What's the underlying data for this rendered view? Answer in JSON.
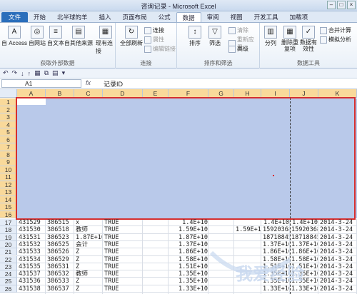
{
  "window": {
    "title": "咨询记录 - Microsoft Excel"
  },
  "tabs": [
    "文件",
    "开始",
    "北半球的羊",
    "插入",
    "页面布局",
    "公式",
    "数据",
    "审阅",
    "视图",
    "开发工具",
    "加载项"
  ],
  "ribbon": {
    "group1": {
      "label": "获取外部数据",
      "buttons": [
        "自 Access",
        "自网站",
        "自文本",
        "自其他来源",
        "现有连接"
      ]
    },
    "group2": {
      "label": "连接",
      "buttons": [
        "全部刷新"
      ],
      "small": [
        "连接",
        "属性",
        "编辑链接"
      ]
    },
    "group3": {
      "label": "排序和筛选",
      "buttons": [
        "排序",
        "筛选"
      ],
      "small": [
        "清除",
        "重新应用",
        "高级"
      ]
    },
    "group4": {
      "label": "数据工具",
      "buttons": [
        "分列",
        "删除重复项",
        "数据有效性",
        "合并计算",
        "模拟分析"
      ]
    }
  },
  "formula_bar": {
    "name_box": "A1",
    "fx": "fx",
    "value": "记录ID"
  },
  "columns": [
    "A",
    "B",
    "C",
    "D",
    "E",
    "F",
    "G",
    "H",
    "I",
    "J",
    "K"
  ],
  "selected_rows": [
    "1",
    "2",
    "3",
    "4",
    "5",
    "6",
    "7",
    "8",
    "9",
    "10",
    "11",
    "12",
    "13",
    "14",
    "15",
    "16"
  ],
  "rows": [
    {
      "n": "17",
      "a": "431529",
      "b": "386515",
      "c": "x",
      "d": "TRUE",
      "f": "1.4E+10",
      "h": "",
      "i": "1.4E+10",
      "j": "1.4E+10",
      "k": "2014-3-24"
    },
    {
      "n": "18",
      "a": "431530",
      "b": "386518",
      "c": "教师",
      "d": "TRUE",
      "f": "1.59E+10",
      "h": "1.59E+10",
      "i": "15920368(",
      "j": "15920368(",
      "k": "2014-3-24"
    },
    {
      "n": "19",
      "a": "431531",
      "b": "386523",
      "c": "1.87E+10",
      "d": "TRUE",
      "f": "1.87E+10",
      "h": "",
      "i": "18718845(",
      "j": "18718845(",
      "k": "2014-3-24"
    },
    {
      "n": "20",
      "a": "431532",
      "b": "386525",
      "c": "会计",
      "d": "TRUE",
      "f": "1.37E+10",
      "h": "",
      "i": "1.37E+10",
      "j": "1.37E+10",
      "k": "2014-3-24"
    },
    {
      "n": "21",
      "a": "431533",
      "b": "386526",
      "c": "Z",
      "d": "TRUE",
      "f": "1.86E+10",
      "h": "",
      "i": "1.86E+10",
      "j": "1.86E+10",
      "k": "2014-3-24"
    },
    {
      "n": "22",
      "a": "431534",
      "b": "386529",
      "c": "Z",
      "d": "TRUE",
      "f": "1.58E+10",
      "h": "",
      "i": "1.58E+10",
      "j": "1.58E+10",
      "k": "2014-3-24"
    },
    {
      "n": "23",
      "a": "431535",
      "b": "386531",
      "c": "Z",
      "d": "TRUE",
      "f": "1.51E+10",
      "h": "",
      "i": "1.51E+10",
      "j": "1.51E+10",
      "k": "2014-3-24"
    },
    {
      "n": "24",
      "a": "431537",
      "b": "386532",
      "c": "教师",
      "d": "TRUE",
      "f": "1.35E+10",
      "h": "",
      "i": "1.35E+10",
      "j": "1.35E+10",
      "k": "2014-3-24"
    },
    {
      "n": "25",
      "a": "431536",
      "b": "386533",
      "c": "Z",
      "d": "TRUE",
      "f": "1.35E+10",
      "h": "",
      "i": "1.35E+10",
      "j": "1.35E+10",
      "k": "2014-3-24"
    },
    {
      "n": "26",
      "a": "431538",
      "b": "386537",
      "c": "Z",
      "d": "TRUE",
      "f": "1.33E+10",
      "h": "",
      "i": "1.33E+10",
      "j": "1.33E+10",
      "k": "2014-3-24"
    }
  ],
  "watermark": {
    "text": "我爱经验"
  },
  "colors": {
    "selection": "#b9c9ea",
    "frame": "#d62f2f",
    "file_tab": "#2a6ebb",
    "header_selected": "#f9d99a"
  }
}
